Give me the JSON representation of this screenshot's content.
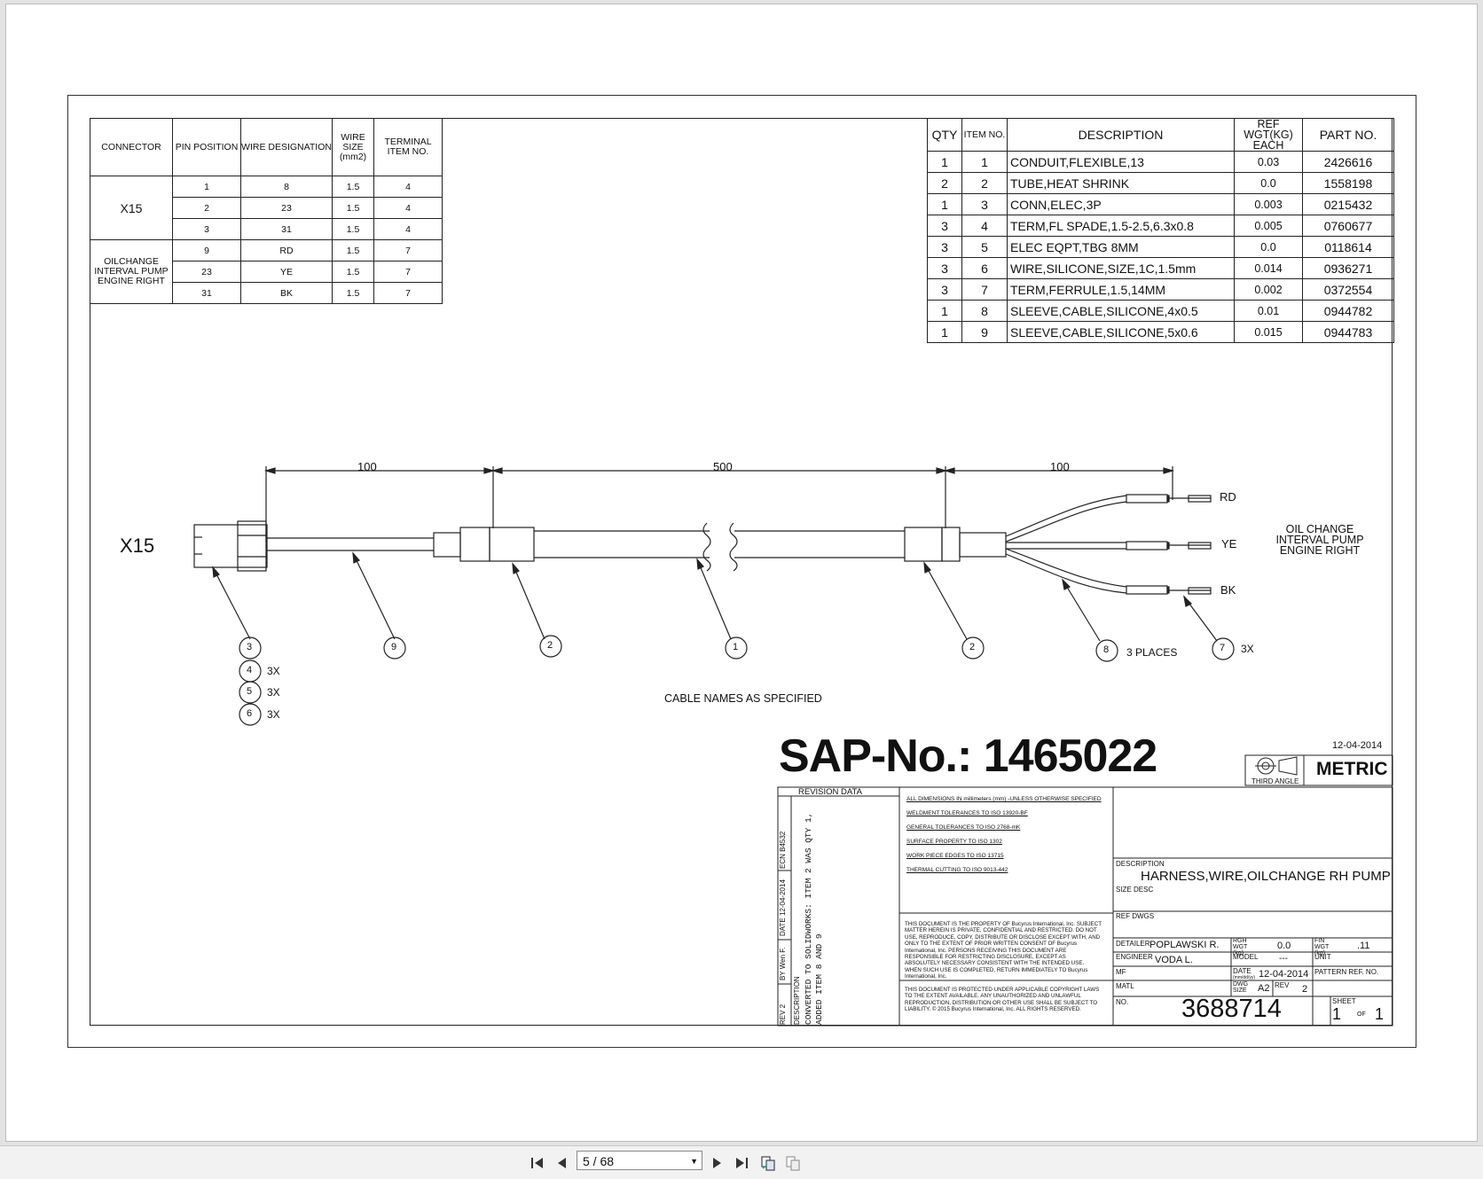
{
  "viewer": {
    "page_field": "5 / 68",
    "buttons": {
      "first": "first-page",
      "prev": "previous-page",
      "next": "next-page",
      "last": "last-page",
      "view1": "page-layout",
      "view2": "page-layout-2"
    }
  },
  "connector_table": {
    "headers": [
      "CONNECTOR",
      "PIN POSITION",
      "WIRE DESIGNATION",
      "WIRE SIZE (mm2)",
      "TERMINAL ITEM NO."
    ],
    "group1_name": "X15",
    "group2_name": "OILCHANGE INTERVAL PUMP ENGINE RIGHT",
    "rows": [
      {
        "pin": "1",
        "wire": "8",
        "size": "1.5",
        "term": "4"
      },
      {
        "pin": "2",
        "wire": "23",
        "size": "1.5",
        "term": "4"
      },
      {
        "pin": "3",
        "wire": "31",
        "size": "1.5",
        "term": "4"
      },
      {
        "pin": "9",
        "wire": "RD",
        "size": "1.5",
        "term": "7"
      },
      {
        "pin": "23",
        "wire": "YE",
        "size": "1.5",
        "term": "7"
      },
      {
        "pin": "31",
        "wire": "BK",
        "size": "1.5",
        "term": "7"
      }
    ]
  },
  "bom": {
    "headers": [
      "QTY",
      "ITEM NO.",
      "DESCRIPTION",
      "REF WGT(KG) EACH",
      "PART NO."
    ],
    "rows": [
      {
        "qty": "1",
        "item": "1",
        "desc": "CONDUIT,FLEXIBLE,13",
        "wgt": "0.03",
        "part": "2426616"
      },
      {
        "qty": "2",
        "item": "2",
        "desc": "TUBE,HEAT SHRINK",
        "wgt": "0.0",
        "part": "1558198"
      },
      {
        "qty": "1",
        "item": "3",
        "desc": "CONN,ELEC,3P",
        "wgt": "0.003",
        "part": "0215432"
      },
      {
        "qty": "3",
        "item": "4",
        "desc": "TERM,FL SPADE,1.5-2.5,6.3x0.8",
        "wgt": "0.005",
        "part": "0760677"
      },
      {
        "qty": "3",
        "item": "5",
        "desc": "ELEC EQPT,TBG 8MM",
        "wgt": "0.0",
        "part": "0118614"
      },
      {
        "qty": "3",
        "item": "6",
        "desc": "WIRE,SILICONE,SIZE,1C,1.5mm",
        "wgt": "0.014",
        "part": "0936271"
      },
      {
        "qty": "3",
        "item": "7",
        "desc": "TERM,FERRULE,1.5,14MM",
        "wgt": "0.002",
        "part": "0372554"
      },
      {
        "qty": "1",
        "item": "8",
        "desc": "SLEEVE,CABLE,SILICONE,4x0.5",
        "wgt": "0.01",
        "part": "0944782"
      },
      {
        "qty": "1",
        "item": "9",
        "desc": "SLEEVE,CABLE,SILICONE,5x0.6",
        "wgt": "0.015",
        "part": "0944783"
      }
    ]
  },
  "drawing": {
    "dims": [
      "100",
      "500",
      "100"
    ],
    "connector_label": "X15",
    "wire_labels": [
      "RD",
      "YE",
      "BK"
    ],
    "end_label": "OIL CHANGE INTERVAL PUMP ENGINE RIGHT",
    "balloons": {
      "b3": "3",
      "b4": "4",
      "b5": "5",
      "b6": "6",
      "b9": "9",
      "b2a": "2",
      "b1": "1",
      "b2b": "2",
      "b8": "8",
      "b7": "7"
    },
    "qty_3x": "3X",
    "three_places": "3 PLACES",
    "note": "CABLE NAMES AS SPECIFIED"
  },
  "title_block": {
    "sap": "SAP-No.: 1465022",
    "date_top": "12-04-2014",
    "third_angle": "THIRD ANGLE",
    "metric": "METRIC",
    "revision_header": "REVISION DATA",
    "rev_row": {
      "rev_label": "REV",
      "rev": "2",
      "by_label": "BY",
      "by": "Wen F.",
      "date_label": "DATE",
      "date": "12-04-2014",
      "ecn_label": "ECN",
      "ecn": "B4532",
      "desc_label": "DESCRIPTION",
      "desc1": "CONVERTED TO SOLIDWORKS: ITEM 2 WAS QTY 1,",
      "desc2": "ADDED ITEM 8 AND 9"
    },
    "notes": [
      "ALL DIMENSIONS IN millimeters (mm) -UNLESS OTHERWISE SPECIFIED",
      "WELDMENT TOLERANCES TO ISO 13920-BF",
      "GENERAL TOLERANCES TO ISO 2768-mK",
      "SURFACE PROPERTY TO ISO 1302",
      "WORK PIECE EDGES TO ISO 13715",
      "THERMAL CUTTING TO ISO 9013-442"
    ],
    "property_text": "THIS DOCUMENT IS THE PROPERTY OF Bucyrus International, Inc. SUBJECT MATTER HEREIN IS PRIVATE, CONFIDENTIAL AND RESTRICTED. DO NOT USE, REPRODUCE, COPY, DISTRIBUTE OR DISCLOSE EXCEPT WITH, AND ONLY TO THE EXTENT OF PRIOR WRITTEN CONSENT OF Bucyrus International, Inc. PERSONS RECEIVING THIS DOCUMENT ARE RESPONSIBLE FOR RESTRICTING DISCLOSURE, EXCEPT AS ABSOLUTELY NECESSARY CONSISTENT WITH THE INTENDED USE. WHEN SUCH USE IS COMPLETED, RETURN IMMEDIATELY TO Bucyrus International, Inc.",
    "copyright_text": "THIS DOCUMENT IS PROTECTED UNDER APPLICABLE COPYRIGHT LAWS TO THE EXTENT AVAILABLE. ANY UNAUTHORIZED AND UNLAWFUL REPRODUCTION, DISTRIBUTION OR OTHER USE SHALL BE SUBJECT TO LIABILITY. © 2015 Bucyrus International, Inc. ALL RIGHTS RESERVED.",
    "description_label": "DESCRIPTION",
    "description": "HARNESS,WIRE,OILCHANGE RH PUMP",
    "size_desc_label": "SIZE DESC",
    "ref_dwgs_label": "REF DWGS",
    "detailer_label": "DETAILER",
    "detailer": "POPLAWSKI R.",
    "rgh_wgt_label": "RGH WGT (kg)",
    "rgh_wgt": "0.0",
    "fin_wgt_label": "FIN WGT (kg)",
    "fin_wgt": ".11",
    "engineer_label": "ENGINEER",
    "engineer": "VODA L.",
    "model_label": "MODEL",
    "model": "---",
    "unit_label": "UNIT",
    "mf_label": "MF",
    "date_label": "DATE",
    "date_sub": "(mm/dd/yy)",
    "date": "12-04-2014",
    "pattern_label": "PATTERN REF. NO.",
    "matl_label": "MATL",
    "dwg_size_label": "DWG SIZE",
    "dwg_size": "A2",
    "rev_label": "REV",
    "rev": "2",
    "no_label": "NO.",
    "drawing_no": "3688714",
    "sheet_label": "SHEET",
    "sheet": "1",
    "of_label": "OF",
    "sheet_total": "1"
  }
}
